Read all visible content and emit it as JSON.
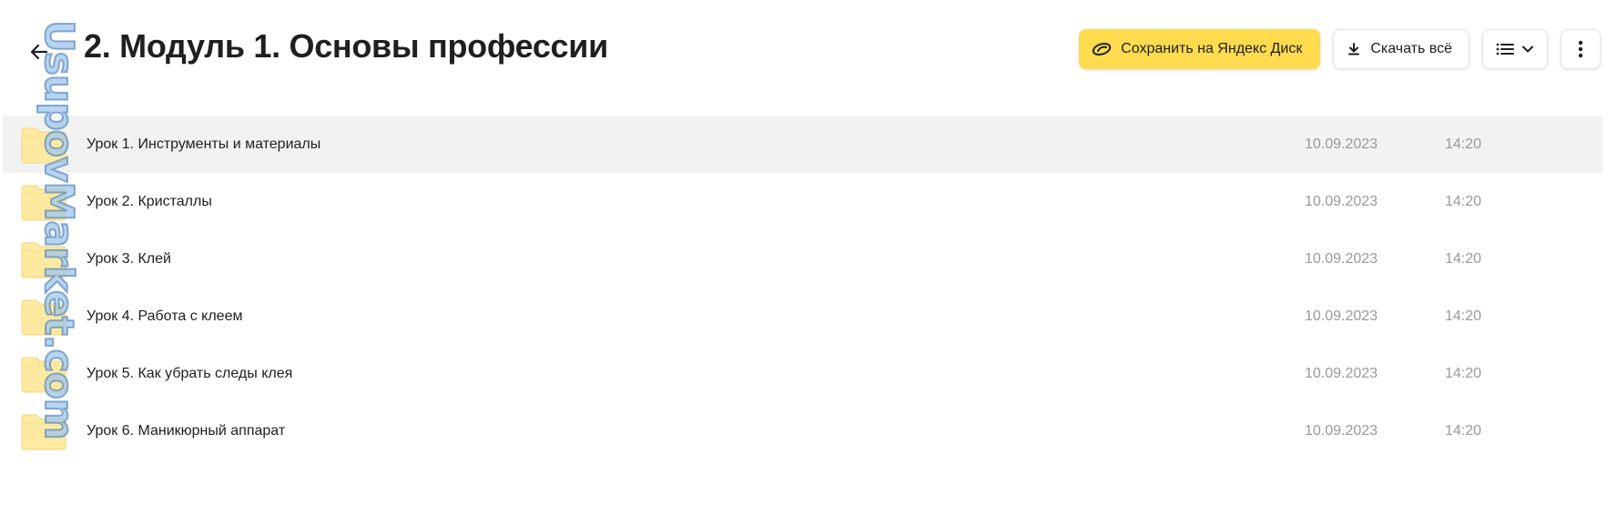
{
  "header": {
    "title": "2. Модуль 1. Основы профессии",
    "back_icon": "arrow-left-icon"
  },
  "toolbar": {
    "save_label": "Сохранить на Яндекс Диск",
    "download_label": "Скачать всё",
    "view_icon": "list-view-icon",
    "more_icon": "more-vertical-icon"
  },
  "files": [
    {
      "name": "Урок 1. Инструменты и материалы",
      "date": "10.09.2023",
      "time": "14:20",
      "selected": true
    },
    {
      "name": "Урок 2. Кристаллы",
      "date": "10.09.2023",
      "time": "14:20",
      "selected": false
    },
    {
      "name": "Урок 3. Клей",
      "date": "10.09.2023",
      "time": "14:20",
      "selected": false
    },
    {
      "name": "Урок 4. Работа с клеем",
      "date": "10.09.2023",
      "time": "14:20",
      "selected": false
    },
    {
      "name": "Урок 5. Как убрать следы клея",
      "date": "10.09.2023",
      "time": "14:20",
      "selected": false
    },
    {
      "name": "Урок 6. Маникюрный аппарат",
      "date": "10.09.2023",
      "time": "14:20",
      "selected": false
    }
  ],
  "watermark": {
    "text": "UsupovMarket.com"
  },
  "colors": {
    "accent_yellow": "#ffdb4d",
    "folder_yellow": "#fdeaa0",
    "row_selected": "#f2f2f2",
    "meta_text": "#999999"
  }
}
